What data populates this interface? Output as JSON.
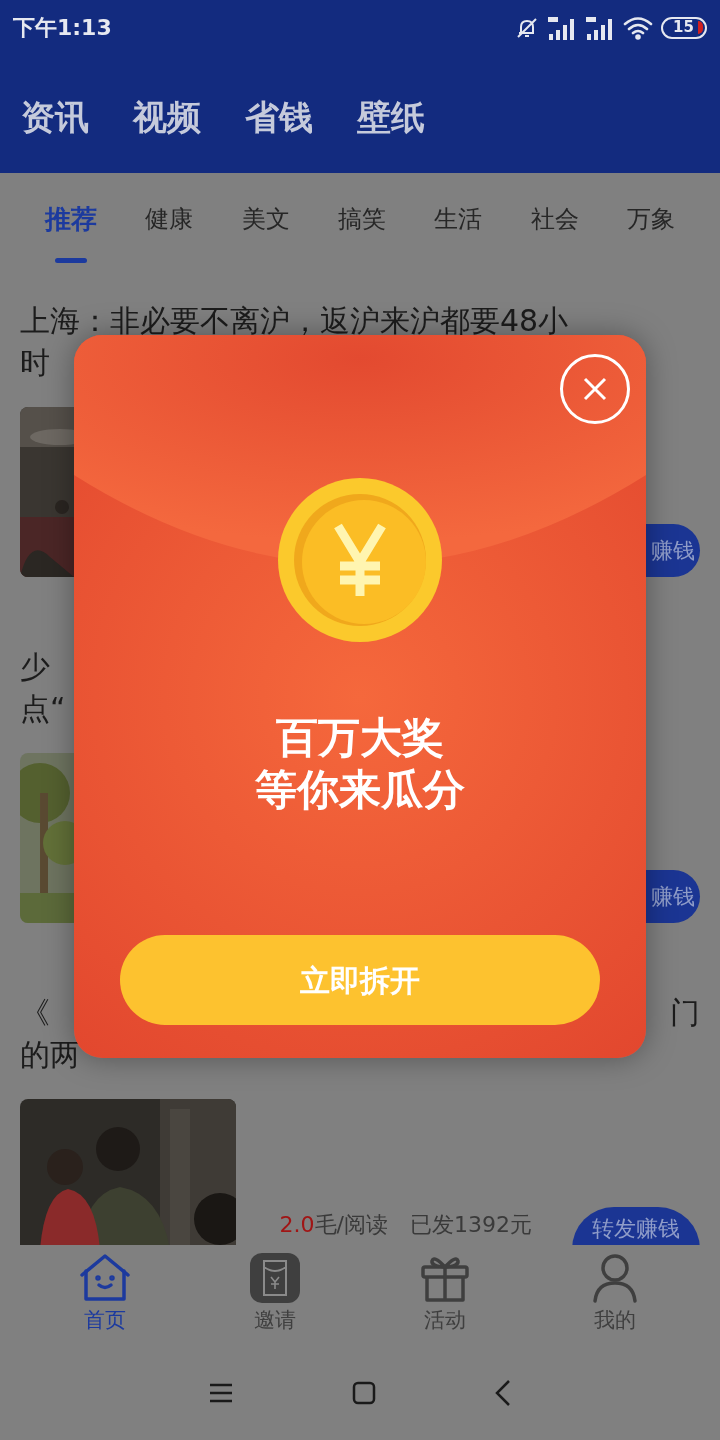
{
  "status_bar": {
    "time": "下午1:13",
    "battery": "15"
  },
  "top_tabs": [
    {
      "label": "资讯"
    },
    {
      "label": "视频"
    },
    {
      "label": "省钱"
    },
    {
      "label": "壁纸"
    }
  ],
  "category_tabs": [
    {
      "label": "推荐",
      "selected": true
    },
    {
      "label": "健康",
      "selected": false
    },
    {
      "label": "美文",
      "selected": false
    },
    {
      "label": "搞笑",
      "selected": false
    },
    {
      "label": "生活",
      "selected": false
    },
    {
      "label": "社会",
      "selected": false
    },
    {
      "label": "万象",
      "selected": false
    }
  ],
  "articles": [
    {
      "kind": "covered",
      "title_lines": [
        {
          "left": "上海：非必要不离沪，返沪来沪都要48小"
        },
        {
          "left": "时"
        }
      ],
      "button": "赚钱"
    },
    {
      "kind": "covered",
      "title_lines": [
        {
          "left": "少"
        },
        {
          "left": "点“"
        }
      ],
      "button": "赚钱"
    },
    {
      "kind": "full",
      "title_lines": [
        {
          "left": "《",
          "right": "门"
        },
        {
          "left": "的两"
        }
      ],
      "reward_amount": "2.0",
      "reward_unit": "毛/阅读",
      "paid": "已发1392元",
      "button": "转发赚钱"
    }
  ],
  "bottom_nav": [
    {
      "kind": "home",
      "label": "首页",
      "selected": true
    },
    {
      "kind": "envelope",
      "label": "邀请",
      "selected": false
    },
    {
      "kind": "gift",
      "label": "活动",
      "selected": false
    },
    {
      "kind": "person",
      "label": "我的",
      "selected": false
    }
  ],
  "popup": {
    "headline_lines": [
      "百万大奖",
      "等你来瓜分"
    ],
    "button": "立即拆开"
  }
}
